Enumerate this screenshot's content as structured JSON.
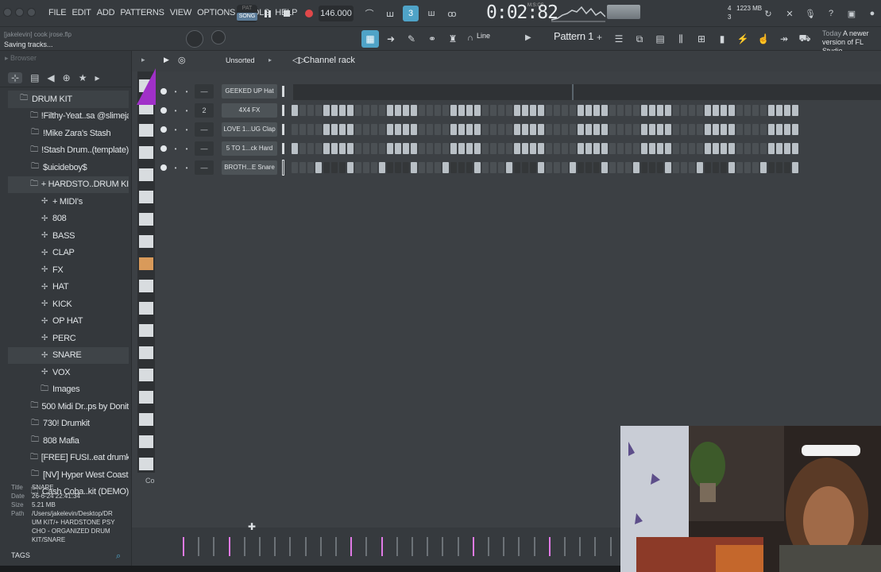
{
  "menu": [
    "FILE",
    "EDIT",
    "ADD",
    "PATTERNS",
    "VIEW",
    "OPTIONS",
    "TOOLS",
    "HELP"
  ],
  "transport": {
    "mode_pat": "PAT",
    "mode_song": "SONG",
    "tempo": "146.000",
    "time": "0:02:82",
    "time_label": "M:S:CS",
    "cpu_mem": "1223 MB",
    "cpu_top": "4",
    "cpu_bottom": "3"
  },
  "hint": {
    "file": "[jakelevin] cook jrose.flp",
    "status": "Saving tracks..."
  },
  "toolbar": {
    "snap": "Line",
    "pattern": "Pattern 1"
  },
  "news": {
    "label": "Today",
    "text": "A newer version of FL Studio"
  },
  "browser": {
    "title": "Browser",
    "tree": [
      {
        "label": "DRUM KIT",
        "level": 0,
        "icon": "folder-icon"
      },
      {
        "label": "!Filthy-Yeat..sa @slimejax",
        "level": 1,
        "icon": "folder-icon"
      },
      {
        "label": "!Mike Zara's Stash",
        "level": 1,
        "icon": "folder-icon"
      },
      {
        "label": "!Stash Drum..(template)",
        "level": 1,
        "icon": "folder-icon"
      },
      {
        "label": "$uicideboy$",
        "level": 1,
        "icon": "folder-icon"
      },
      {
        "label": "+ HARDSTO..DRUM KIT",
        "level": 1,
        "icon": "folder-icon",
        "highlight": true
      },
      {
        "label": "+ MIDI's",
        "level": 2,
        "icon": "sample-folder-icon"
      },
      {
        "label": "808",
        "level": 2,
        "icon": "sample-folder-icon"
      },
      {
        "label": "BASS",
        "level": 2,
        "icon": "sample-folder-icon"
      },
      {
        "label": "CLAP",
        "level": 2,
        "icon": "sample-folder-icon"
      },
      {
        "label": "FX",
        "level": 2,
        "icon": "sample-folder-icon"
      },
      {
        "label": "HAT",
        "level": 2,
        "icon": "sample-folder-icon"
      },
      {
        "label": "KICK",
        "level": 2,
        "icon": "sample-folder-icon"
      },
      {
        "label": "OP HAT",
        "level": 2,
        "icon": "sample-folder-icon"
      },
      {
        "label": "PERC",
        "level": 2,
        "icon": "sample-folder-icon"
      },
      {
        "label": "SNARE",
        "level": 2,
        "icon": "sample-folder-icon",
        "highlight": true
      },
      {
        "label": "VOX",
        "level": 2,
        "icon": "sample-folder-icon"
      },
      {
        "label": "Images",
        "level": 2,
        "icon": "folder-icon"
      },
      {
        "label": "500 Midi Dr..ps by Donit",
        "level": 1,
        "icon": "folder-icon"
      },
      {
        "label": "730! Drumkit",
        "level": 1,
        "icon": "folder-icon"
      },
      {
        "label": "808 Mafia",
        "level": 1,
        "icon": "folder-icon"
      },
      {
        "label": "[FREE] FUSI..eat drumkit",
        "level": 1,
        "icon": "folder-icon"
      },
      {
        "label": "[NV] Hyper West Coast",
        "level": 1,
        "icon": "folder-icon"
      },
      {
        "label": "Cash Coba..kit (DEMO)",
        "level": 1,
        "icon": "folder-icon"
      }
    ],
    "info": {
      "title_key": "Title",
      "title_val": "SNARE",
      "date_key": "Date",
      "date_val": "26-6-24 22:41:34",
      "size_key": "Size",
      "size_val": "5.21 MB",
      "path_key": "Path",
      "path_val": "/Users/jakelevin/Desktop/DRUM KIT/+ HARDSTONE PSYCHO - ORGANIZED DRUM KIT/SNARE"
    },
    "tags": "TAGS"
  },
  "rack": {
    "title": "Channel rack",
    "group": "Unsorted",
    "corner_label": "Co",
    "channels": [
      {
        "name": "GEEKED UP Hat",
        "num": "—",
        "steps": "0000000000000000000000000000000000000000000000000000000000000000"
      },
      {
        "name": "4X4 FX",
        "num": "2",
        "steps": "1000111100001111000011110000111100001111000011110000111100001111"
      },
      {
        "name": "LOVE 1...UG Clap",
        "num": "—",
        "steps": "0000111100001111000011110000111100001111000011110000111100001111"
      },
      {
        "name": "5 TO 1...ck Hard",
        "num": "—",
        "steps": "1000111100001111000011110000111100001111000011110000111100001111"
      },
      {
        "name": "BROTH...E Snare",
        "num": "—",
        "steps": "0001000100010001000100010001000100010001000100010001000100010001"
      }
    ]
  },
  "colors": {
    "accent_purple": "#a030c8",
    "accent_orange": "#d99a5a",
    "pink_marker": "#e07ae6",
    "step_on": "#b9c0c6"
  }
}
